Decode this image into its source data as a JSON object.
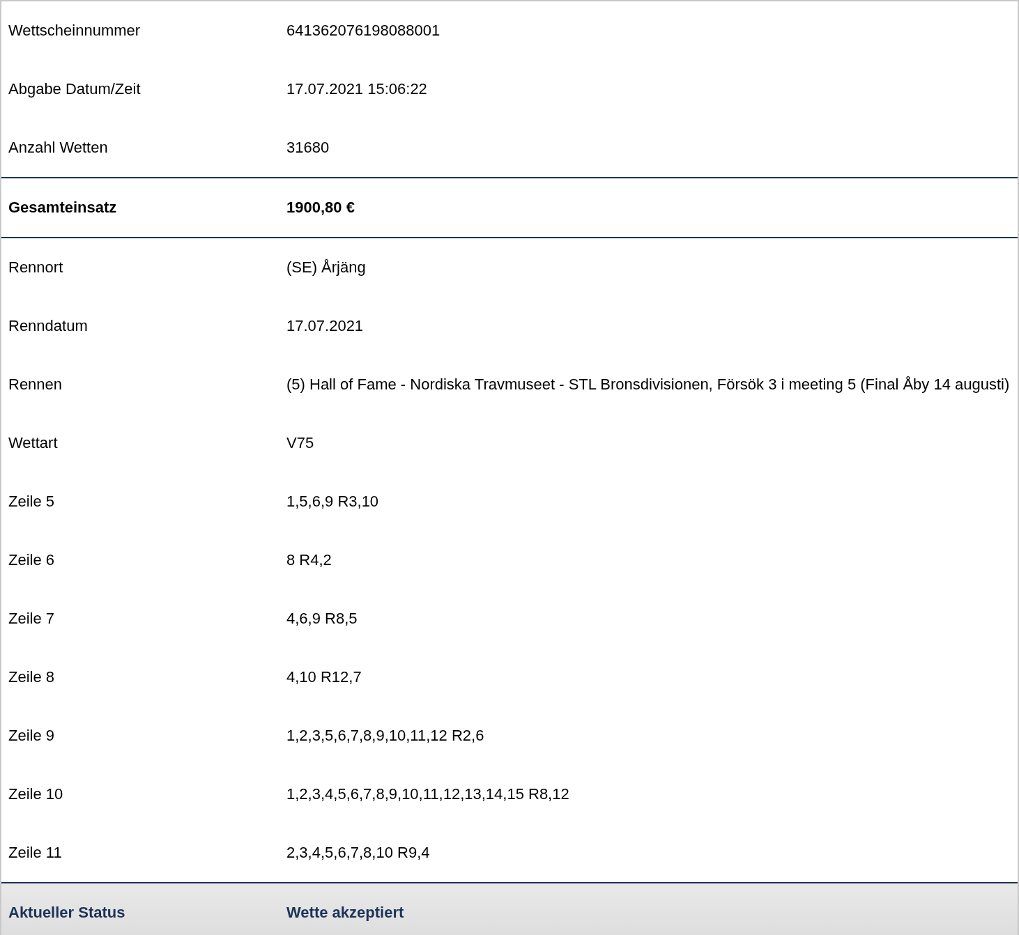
{
  "sections": [
    {
      "kind": "normal",
      "rows": [
        {
          "label": "Wettscheinnummer",
          "value": "641362076198088001"
        },
        {
          "label": "Abgabe Datum/Zeit",
          "value": "17.07.2021 15:06:22"
        },
        {
          "label": "Anzahl Wetten",
          "value": "31680"
        }
      ]
    },
    {
      "kind": "total",
      "rows": [
        {
          "label": "Gesamteinsatz",
          "value": "1900,80 €"
        }
      ]
    },
    {
      "kind": "normal",
      "rows": [
        {
          "label": "Rennort",
          "value": "(SE) Årjäng"
        },
        {
          "label": "Renndatum",
          "value": "17.07.2021"
        },
        {
          "label": "Rennen",
          "value": "(5) Hall of Fame - Nordiska Travmuseet - STL Bronsdivisionen, Försök 3 i meeting 5 (Final Åby 14 augusti)"
        },
        {
          "label": "Wettart",
          "value": "V75"
        },
        {
          "label": "Zeile 5",
          "value": "1,5,6,9 R3,10"
        },
        {
          "label": "Zeile 6",
          "value": "8 R4,2"
        },
        {
          "label": "Zeile 7",
          "value": "4,6,9 R8,5"
        },
        {
          "label": "Zeile 8",
          "value": "4,10 R12,7"
        },
        {
          "label": "Zeile 9",
          "value": "1,2,3,5,6,7,8,9,10,11,12 R2,6"
        },
        {
          "label": "Zeile 10",
          "value": "1,2,3,4,5,6,7,8,9,10,11,12,13,14,15 R8,12"
        },
        {
          "label": "Zeile 11",
          "value": "2,3,4,5,6,7,8,10 R9,4"
        }
      ]
    },
    {
      "kind": "status",
      "rows": [
        {
          "label": "Aktueller Status",
          "value": "Wette akzeptiert"
        }
      ]
    }
  ]
}
